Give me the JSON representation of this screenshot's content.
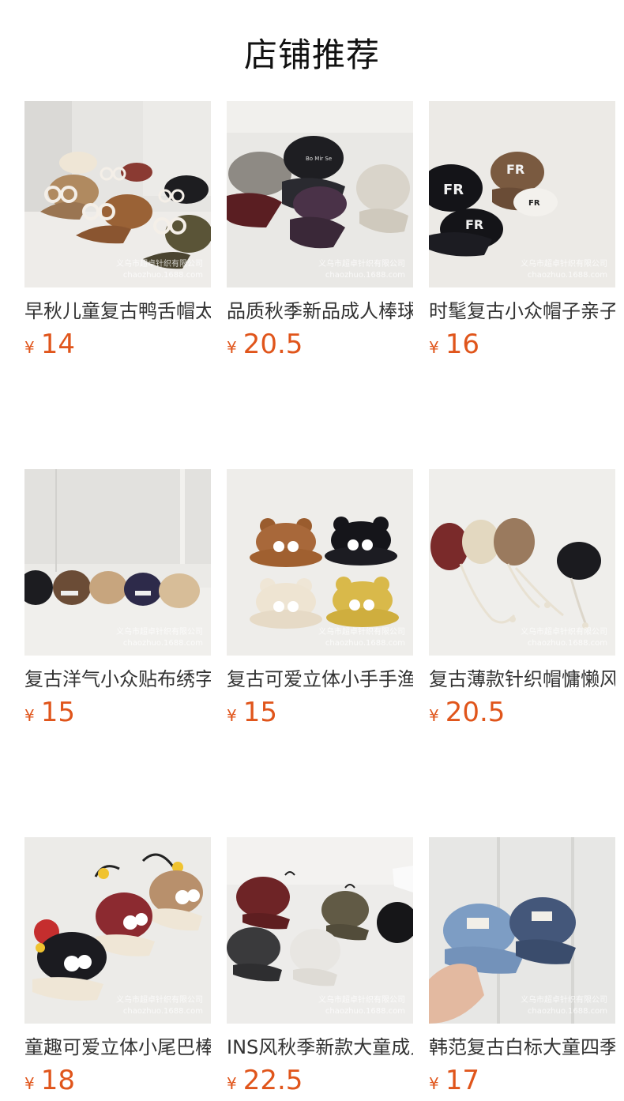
{
  "page_title": "店铺推荐",
  "currency_symbol": "¥",
  "watermark": {
    "line1": "义乌市超卓针织有限公司",
    "line2": "chaozhuo.1688.com"
  },
  "products": [
    {
      "name": "早秋儿童复古鸭舌帽太阳镜",
      "price": "14"
    },
    {
      "name": "品质秋季新品成人棒球帽",
      "price": "20.5"
    },
    {
      "name": "时髦复古小众帽子亲子款",
      "price": "16"
    },
    {
      "name": "复古洋气小众贴布绣字母帽",
      "price": "15"
    },
    {
      "name": "复古可爱立体小手手渔夫帽",
      "price": "15"
    },
    {
      "name": "复古薄款针织帽慵懒风",
      "price": "20.5"
    },
    {
      "name": "童趣可爱立体小尾巴棒球帽",
      "price": "18"
    },
    {
      "name": "INS风秋季新款大童成人帽",
      "price": "22.5"
    },
    {
      "name": "韩范复古白标大童四季帽",
      "price": "17"
    }
  ],
  "colors": {
    "price": "#e0551b",
    "title": "#111111",
    "name": "#333333"
  }
}
